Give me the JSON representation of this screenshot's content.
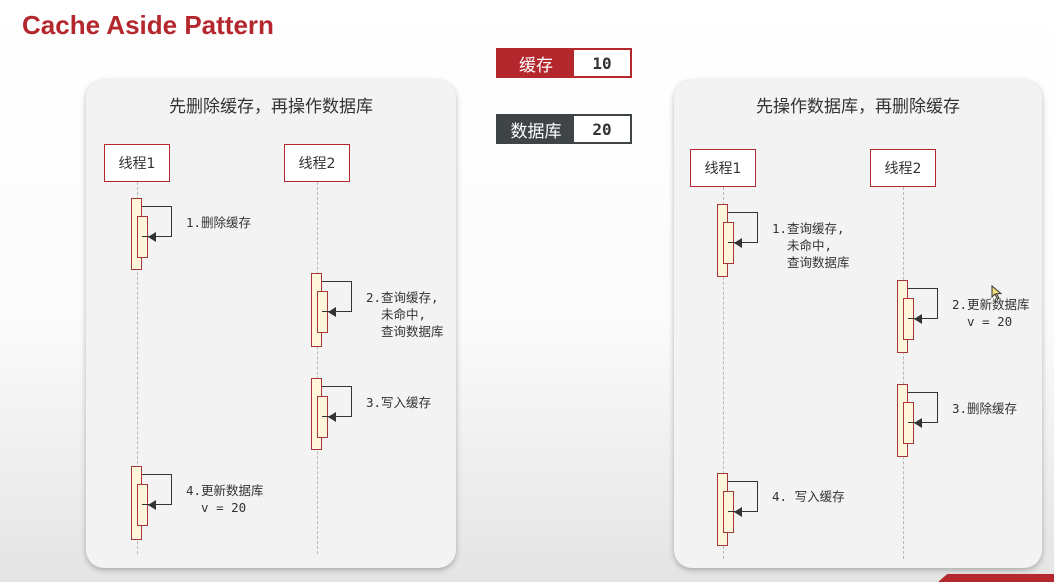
{
  "title": "Cache Aside Pattern",
  "state": {
    "cache": {
      "label": "缓存",
      "value": "10"
    },
    "db": {
      "label": "数据库",
      "value": "20"
    }
  },
  "left_panel": {
    "title": "先删除缓存，再操作数据库",
    "thread1": "线程1",
    "thread2": "线程2",
    "steps": [
      [
        "1.删除缓存"
      ],
      [
        "2.查询缓存,",
        "  未命中,",
        "  查询数据库"
      ],
      [
        "3.写入缓存"
      ],
      [
        "4.更新数据库",
        "  v = 20"
      ]
    ]
  },
  "right_panel": {
    "title": "先操作数据库，再删除缓存",
    "thread1": "线程1",
    "thread2": "线程2",
    "steps": [
      [
        "1.查询缓存,",
        "  未命中,",
        "  查询数据库"
      ],
      [
        "2.更新数据库",
        "  v = 20"
      ],
      [
        "3.删除缓存"
      ],
      [
        "4. 写入缓存"
      ]
    ]
  },
  "colors": {
    "accent": "#b3272d",
    "dark": "#3f4447",
    "activation": "#fff6dc"
  }
}
